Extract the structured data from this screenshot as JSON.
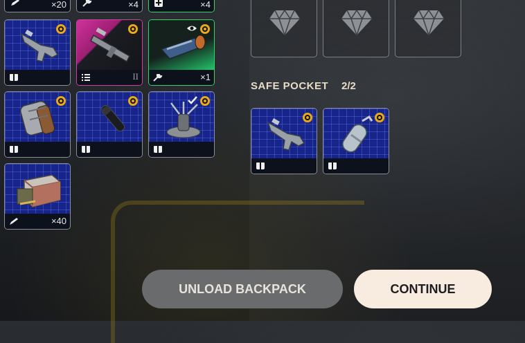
{
  "top_strip": [
    {
      "icon": "pencil-icon",
      "count": "×20"
    },
    {
      "icon": "wrench-icon",
      "count": "×4"
    },
    {
      "icon": "medkit-icon",
      "count": "×4"
    }
  ],
  "backpack_slots": [
    {
      "name": "smg",
      "rarity": "blue",
      "badge": true,
      "footer_icon": "book-icon",
      "count": ""
    },
    {
      "name": "launcher",
      "rarity": "magenta",
      "badge": true,
      "footer_icon": "list-icon",
      "tier": "II"
    },
    {
      "name": "device",
      "rarity": "green",
      "badge": true,
      "eye": true,
      "footer_icon": "wrench-icon",
      "count": "×1"
    },
    {
      "name": "barrel-canister",
      "rarity": "blue",
      "badge": true,
      "footer_icon": "book-icon",
      "count": ""
    },
    {
      "name": "tube",
      "rarity": "blue",
      "badge": true,
      "footer_icon": "book-icon",
      "count": ""
    },
    {
      "name": "gadget",
      "rarity": "blue",
      "badge": true,
      "check": true,
      "footer_icon": "book-icon",
      "count": ""
    },
    {
      "name": "ammo-box",
      "rarity": "blue",
      "badge": false,
      "footer_icon": "pencil-icon",
      "count": "×40"
    }
  ],
  "gem_slots": [
    {
      "icon": "gem-icon"
    },
    {
      "icon": "gem-icon"
    },
    {
      "icon": "gem-icon"
    }
  ],
  "safe_pocket": {
    "title": "SAFE POCKET",
    "count": "2/2",
    "items": [
      {
        "name": "smg",
        "badge": true,
        "footer_icon": "book-icon"
      },
      {
        "name": "gas-canister",
        "badge": true,
        "footer_icon": "book-icon"
      }
    ]
  },
  "buttons": {
    "unload": "UNLOAD BACKPACK",
    "continue": "CONTINUE"
  },
  "colors": {
    "accent_gold": "#e8a91c",
    "rarity_blue": "#17248a",
    "rarity_magenta": "#d0329a",
    "rarity_green": "#2fd46d",
    "continue_bg": "#f8ece0"
  }
}
